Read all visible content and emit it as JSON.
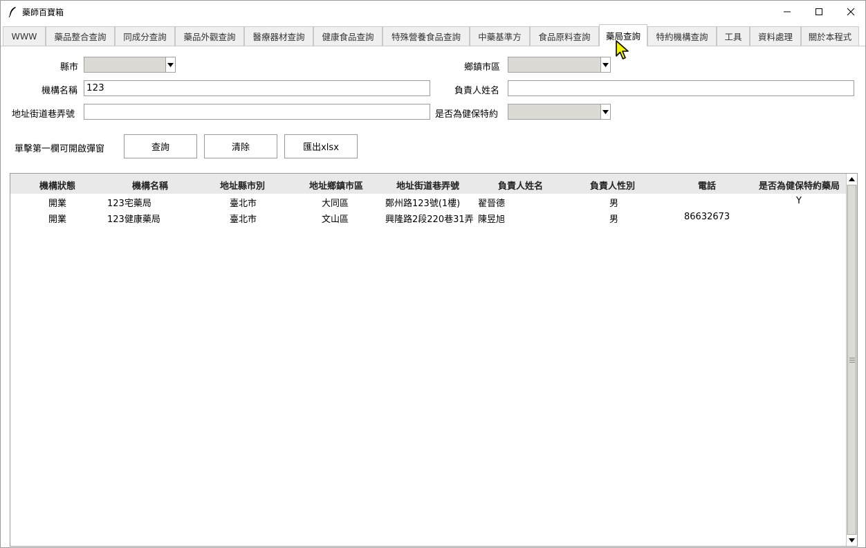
{
  "window": {
    "title": "藥師百寶箱"
  },
  "tabs": [
    {
      "label": "WWW"
    },
    {
      "label": "藥品整合查詢"
    },
    {
      "label": "同成分查詢"
    },
    {
      "label": "藥品外觀查詢"
    },
    {
      "label": "醫療器材查詢"
    },
    {
      "label": "健康食品查詢"
    },
    {
      "label": "特殊營養食品查詢"
    },
    {
      "label": "中藥基準方"
    },
    {
      "label": "食品原料查詢"
    },
    {
      "label": "藥局查詢"
    },
    {
      "label": "特約機構查詢"
    },
    {
      "label": "工具"
    },
    {
      "label": "資料處理"
    },
    {
      "label": "關於本程式"
    }
  ],
  "active_tab": "藥局查詢",
  "form": {
    "county_label": "縣市",
    "county_value": "",
    "township_label": "鄉鎮市區",
    "township_value": "",
    "name_label": "機構名稱",
    "name_value": "123",
    "owner_label": "負責人姓名",
    "owner_value": "",
    "address_label": "地址街道巷弄號",
    "address_value": "",
    "nhi_label": "是否為健保特約",
    "nhi_value": ""
  },
  "actions": {
    "hint": "單擊第一欄可開啟彈窗",
    "query": "查詢",
    "clear": "清除",
    "export": "匯出xlsx"
  },
  "table": {
    "columns": [
      "機構狀態",
      "機構名稱",
      "地址縣市別",
      "地址鄉鎮市區",
      "地址街道巷弄號",
      "負責人姓名",
      "負責人性別",
      "電話",
      "是否為健保特約藥局"
    ],
    "rows": [
      [
        "開業",
        "123宅藥局",
        "臺北市",
        "大同區",
        "鄭州路123號(1樓)",
        "翟晉德",
        "男",
        "",
        "Y"
      ],
      [
        "開業",
        "123健康藥局",
        "臺北市",
        "文山區",
        "興隆路2段220巷31弄",
        "陳昱旭",
        "男",
        "86632673",
        ""
      ]
    ]
  },
  "colors": {
    "accent_cursor": "#f5f500",
    "header_bg": "#e9e9e9",
    "combo_bg": "#dcdad5"
  }
}
